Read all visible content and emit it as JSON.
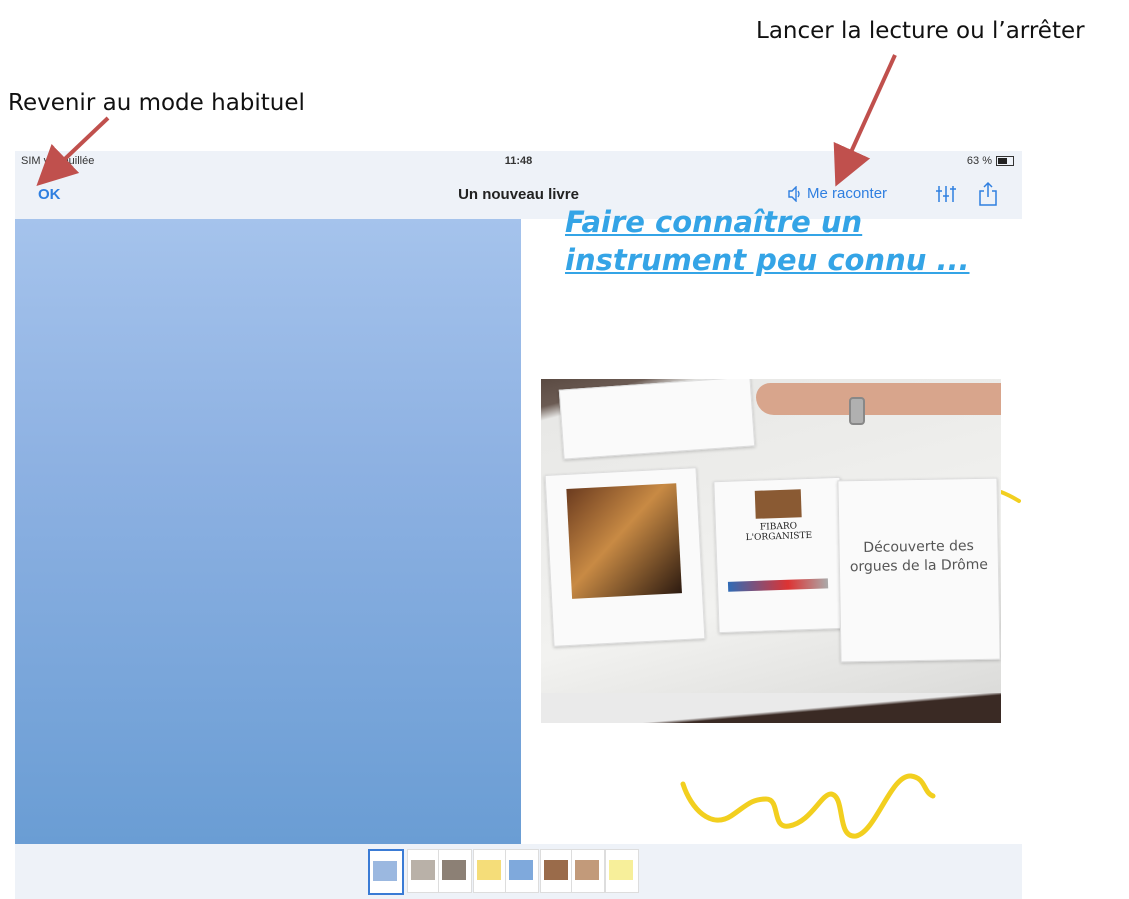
{
  "annotations": {
    "top_right": "Lancer la lecture ou l’arrêter",
    "top_left": "Revenir au mode habituel"
  },
  "status_bar": {
    "carrier": "SIM verrouillée",
    "time": "11:48",
    "battery": "63 %"
  },
  "nav_bar": {
    "ok_label": "OK",
    "title": "Un nouveau livre",
    "read_label": "Me raconter",
    "tools_icon": "sliders-icon",
    "share_icon": "share-icon"
  },
  "page": {
    "title_line_1": "Faire connaître un",
    "title_line_2": "instrument peu connu ...",
    "photo": {
      "flyer_mid_line_1": "FIBARO",
      "flyer_mid_line_2": "L'ORGANISTE",
      "flyer_right_text": "Découverte des orgues de la Drôme"
    }
  },
  "colors": {
    "accent": "#2f7fe0",
    "title": "#34a4e6",
    "doodle": "#f2cf1f",
    "arrow": "#c0504d"
  }
}
